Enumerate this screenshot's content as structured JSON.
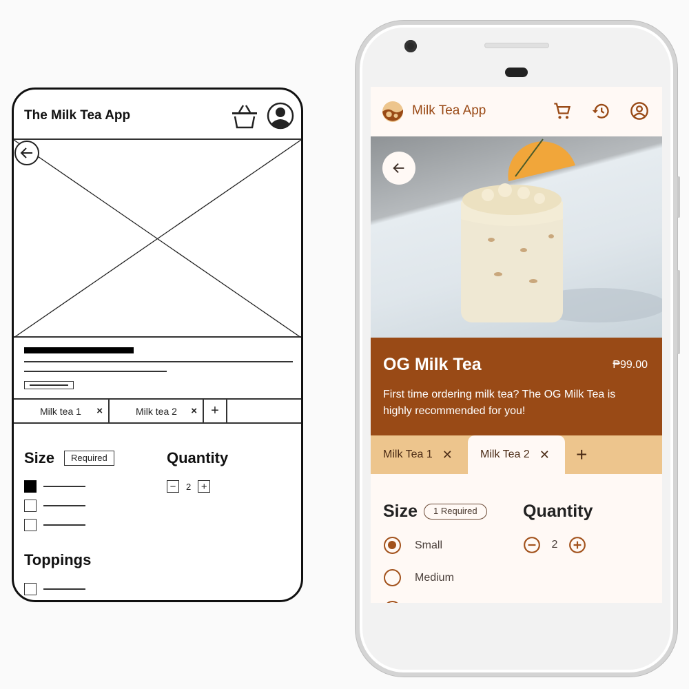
{
  "wireframe": {
    "title": "The Milk Tea App",
    "icons": {
      "cart": "basket-icon",
      "profile": "account-circle-icon",
      "back": "arrow-back-icon"
    },
    "image_placeholder": "image-placeholder",
    "tabs": [
      {
        "label": "Milk tea 1",
        "close": "×"
      },
      {
        "label": "Milk tea 2",
        "close": "×"
      }
    ],
    "add_tab": "+",
    "size": {
      "heading": "Size",
      "badge": "Required",
      "options_selected": [
        true,
        false,
        false
      ]
    },
    "quantity": {
      "heading": "Quantity",
      "minus": "−",
      "value": "2",
      "plus": "+"
    },
    "toppings": {
      "heading": "Toppings",
      "options_selected": [
        false
      ]
    }
  },
  "app": {
    "title": "Milk Tea App",
    "brand_color": "#994a16",
    "accent_light": "#edc58d",
    "background": "#fff9f5",
    "icons": {
      "logo": "milk-tea-logo-icon",
      "cart": "shopping-cart-icon",
      "history": "history-icon",
      "account": "account-circle-icon",
      "back": "arrow-back-icon"
    },
    "product": {
      "name": "OG Milk Tea",
      "price": "₱99.00",
      "description": "First time ordering milk tea? The OG Milk Tea is highly recommended for you!"
    },
    "tabs": [
      {
        "label": "Milk Tea 1",
        "close": "✕",
        "active": false
      },
      {
        "label": "Milk Tea 2",
        "close": "✕",
        "active": true
      }
    ],
    "add_tab": "+",
    "size": {
      "heading": "Size",
      "badge": "1 Required",
      "options": [
        {
          "label": "Small",
          "selected": true
        },
        {
          "label": "Medium",
          "selected": false
        }
      ]
    },
    "quantity": {
      "heading": "Quantity",
      "value": "2"
    }
  }
}
